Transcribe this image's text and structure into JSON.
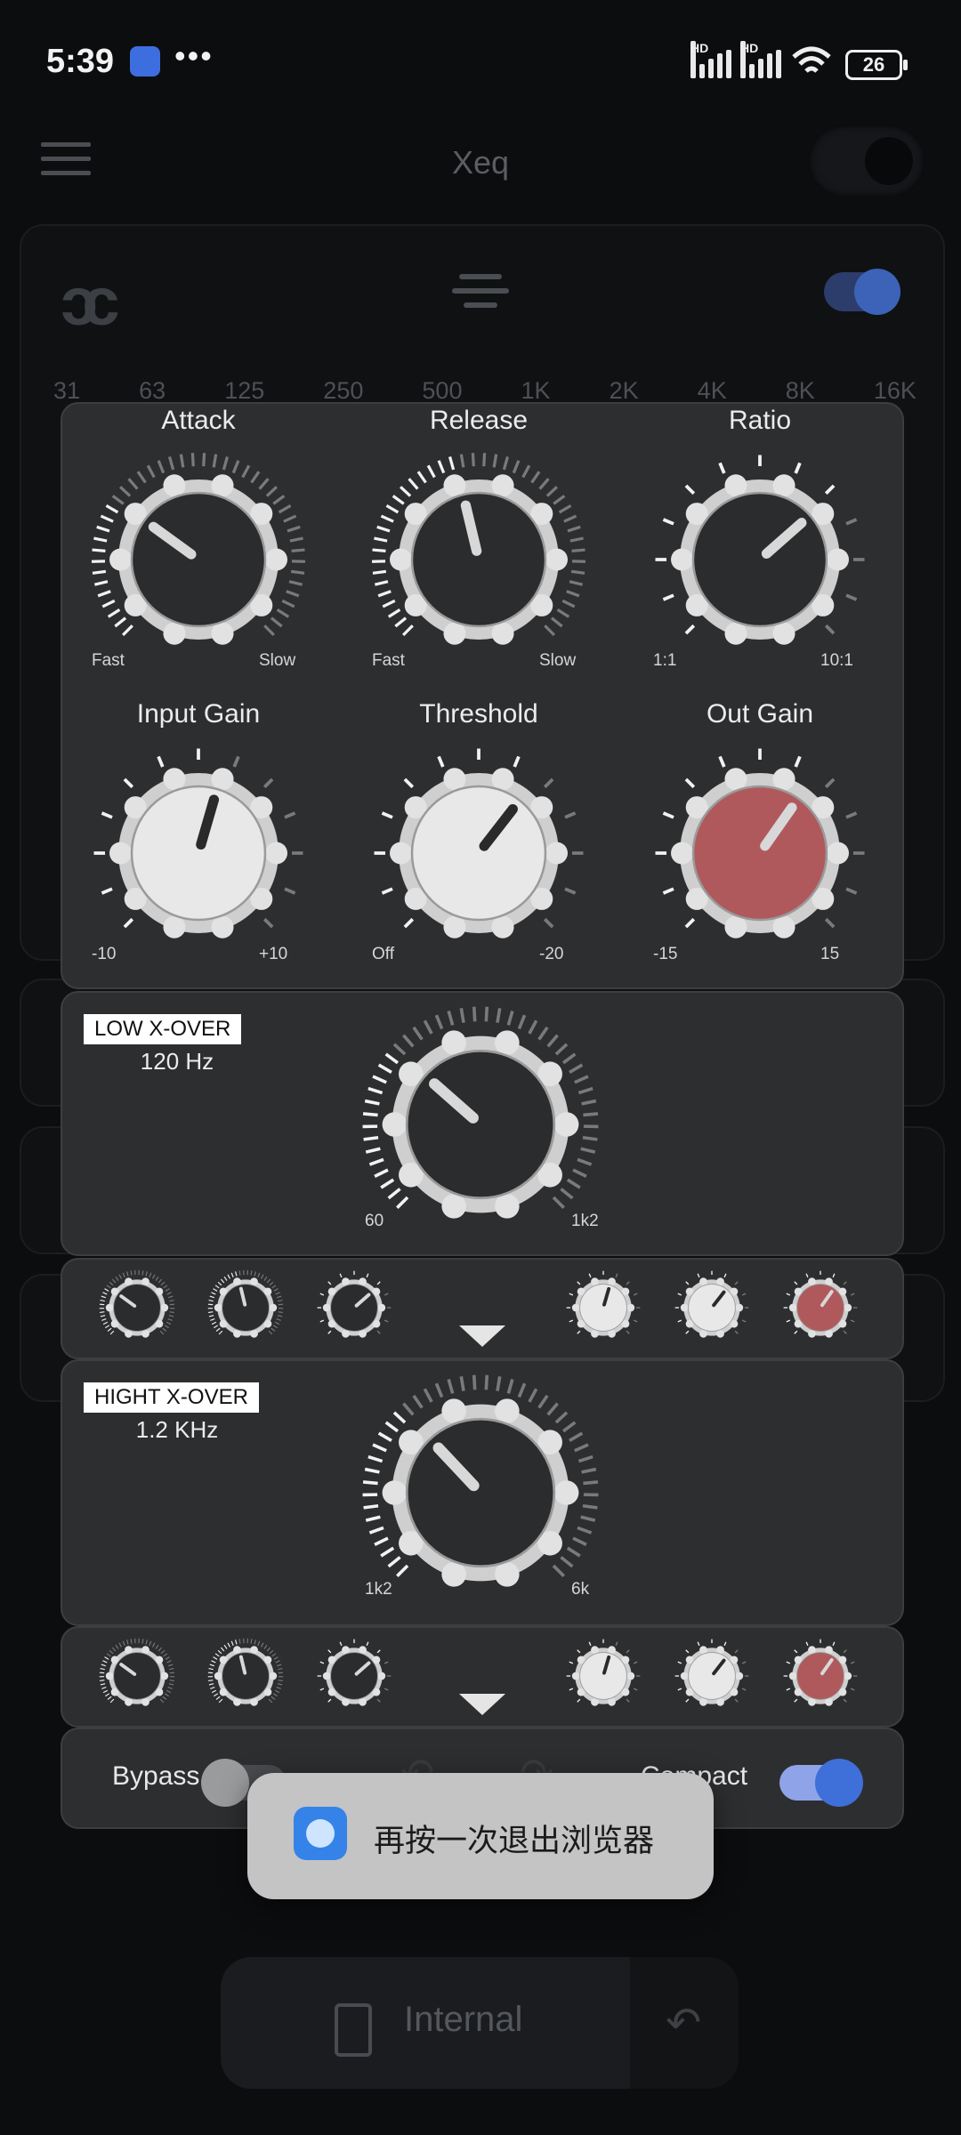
{
  "status_bar": {
    "time": "5:39",
    "dots": "•••",
    "hd1": "HD",
    "hd2": "HD",
    "battery": "26"
  },
  "header": {
    "title": "Xeq"
  },
  "eq": {
    "logo": "ɔc",
    "frequencies": [
      "31",
      "63",
      "125",
      "250",
      "500",
      "1K",
      "2K",
      "4K",
      "8K",
      "16K"
    ]
  },
  "compressor": {
    "knobs": [
      {
        "title": "Attack",
        "min": "Fast",
        "max": "Slow",
        "value_fraction": 0.3,
        "style": "dark"
      },
      {
        "title": "Release",
        "min": "Fast",
        "max": "Slow",
        "value_fraction": 0.45,
        "style": "dark"
      },
      {
        "title": "Ratio",
        "min": "1:1",
        "max": "10:1",
        "value_fraction": 0.68,
        "style": "dark"
      },
      {
        "title": "Input Gain",
        "min": "-10",
        "max": "+10",
        "value_fraction": 0.56,
        "style": "light"
      },
      {
        "title": "Threshold",
        "min": "Off",
        "max": "-20",
        "value_fraction": 0.64,
        "style": "light"
      },
      {
        "title": "Out Gain",
        "min": "-15",
        "max": "15",
        "value_fraction": 0.63,
        "style": "red"
      }
    ]
  },
  "low_crossover": {
    "tag": "LOW X-OVER",
    "value": "120 Hz",
    "min": "60",
    "max": "1k2",
    "value_fraction": 0.32
  },
  "high_crossover": {
    "tag": "HIGHT X-OVER",
    "value": "1.2 KHz",
    "min": "1k2",
    "max": "6k",
    "value_fraction": 0.34
  },
  "mini_knob_fractions": [
    0.3,
    0.45,
    0.68,
    0.56,
    0.64,
    0.63
  ],
  "controls": {
    "bypass_label": "Bypass",
    "compact_label": "Compact",
    "bypass_on": false,
    "compact_on": true
  },
  "toast": {
    "text": "再按一次退出浏览器"
  },
  "bottom": {
    "label": "Internal"
  },
  "colors": {
    "accent": "#3f6fd8",
    "knob_red": "#b0595c",
    "panel": "#2d2e30"
  }
}
